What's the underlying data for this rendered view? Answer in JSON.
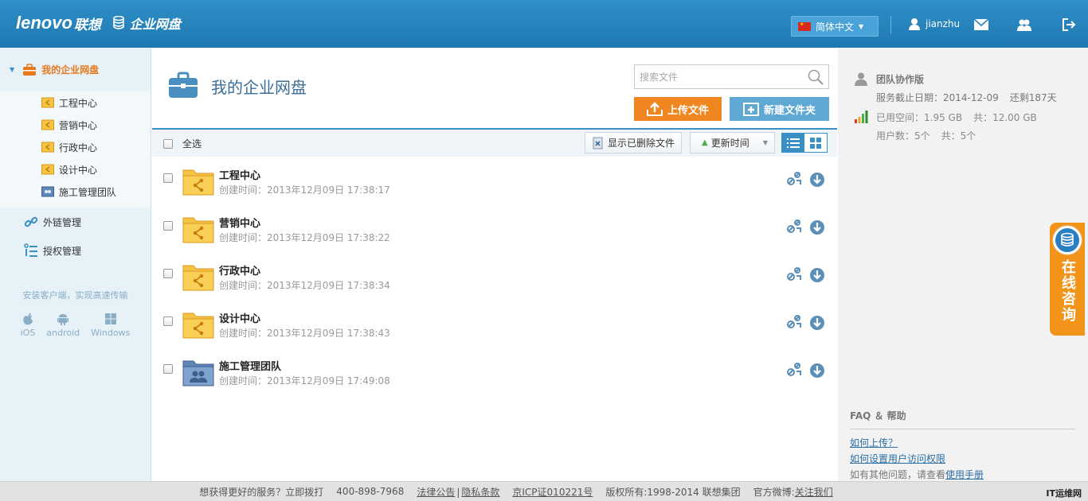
{
  "header": {
    "brand_logo": "lenovo",
    "brand_cn": "联想",
    "app_name": "企业网盘",
    "language": "简体中文",
    "username": "jianzhu"
  },
  "sidebar": {
    "root_label": "我的企业网盘",
    "sub_items": [
      "工程中心",
      "营销中心",
      "行政中心",
      "设计中心",
      "施工管理团队"
    ],
    "links": [
      "外链管理",
      "授权管理"
    ],
    "install_note": "安装客户端，实现高速传输",
    "platforms": [
      "iOS",
      "android",
      "Windows"
    ]
  },
  "main": {
    "title": "我的企业网盘",
    "search_placeholder": "搜索文件",
    "upload_label": "上传文件",
    "newfolder_label": "新建文件夹",
    "select_all": "全选",
    "show_deleted": "显示已删除文件",
    "sort_label": "更新时间",
    "files": [
      {
        "name": "工程中心",
        "meta": "创建时间：2013年12月09日 17:38:17"
      },
      {
        "name": "营销中心",
        "meta": "创建时间：2013年12月09日 17:38:22"
      },
      {
        "name": "行政中心",
        "meta": "创建时间：2013年12月09日 17:38:34"
      },
      {
        "name": "设计中心",
        "meta": "创建时间：2013年12月09日 17:38:43"
      },
      {
        "name": "施工管理团队",
        "meta": "创建时间：2013年12月09日 17:49:08"
      }
    ]
  },
  "right": {
    "plan_name": "团队协作版",
    "service_expiry": "服务截止日期：2014-12-09",
    "remaining": "还剩187天",
    "used_space": "已用空间：1.95 GB",
    "total_space": "共：12.00 GB",
    "users": "用户数：5个",
    "users_total": "共：5个",
    "faq_title": "FAQ ＆ 帮助",
    "faq_links": [
      "如何上传？",
      "如何设置用户访问权限"
    ],
    "faq_more_prefix": "如有其他问题，请查看",
    "faq_more_link": "使用手册",
    "consult": "在线咨询"
  },
  "footer": {
    "service_text": "想获得更好的服务？立即拨打",
    "phone": "400-898-7968",
    "legal": "法律公告",
    "privacy": "隐私条款",
    "icp": "京ICP证010221号",
    "copyright": "版权所有:1998-2014 联想集团",
    "weibo_prefix": "官方微博:",
    "weibo_link": "关注我们",
    "watermark": "IT运维网"
  },
  "colors": {
    "header_blue": "#2f8fc6",
    "accent_orange": "#f0861f",
    "button_blue": "#5fa8d3",
    "folder_yellow": "#f6c444"
  }
}
